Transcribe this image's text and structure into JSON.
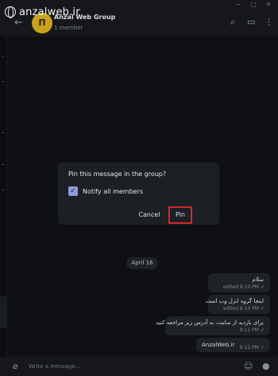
{
  "watermark": {
    "text": "anzalweb.ir"
  },
  "window": {
    "minimize": "−",
    "maximize": "□",
    "close": "✕"
  },
  "header": {
    "back": "←",
    "avatar_letter": "Π",
    "title": "Anzal Web Group",
    "subtitle": "1 member",
    "search_icon": "⌕",
    "channel_icon": "▭",
    "more_icon": "⋮"
  },
  "dialog": {
    "title": "Pin this message in the group?",
    "checkbox_label": "Notify all members",
    "checkbox_checked": true,
    "checkbox_mark": "✓",
    "cancel_label": "Cancel",
    "pin_label": "Pin",
    "highlight_color": "#d6282d"
  },
  "date_divider": "April 16",
  "messages": [
    {
      "text": "سلام",
      "meta": "edited 8:10 PM",
      "tick": "✓"
    },
    {
      "text": "اینجا گروه انزل وب است",
      "meta": "edited 8:10 PM",
      "tick": "✓"
    },
    {
      "text": "برای بازدید از سایت، به آدرس زیر مراجعه کنید",
      "meta": "8:11 PM",
      "tick": "✓"
    },
    {
      "text": "AnzalWeb.ir",
      "meta": "8:12 PM",
      "tick": "✓"
    }
  ],
  "composer": {
    "placeholder": "Write a message...",
    "attach_icon": "⌀",
    "emoji_icon": "☺",
    "mic_icon": "●"
  },
  "colors": {
    "accent": "#8d9bd7",
    "avatar": "#c7a21d",
    "background": "#0e1013",
    "bubble": "#1f2227"
  }
}
